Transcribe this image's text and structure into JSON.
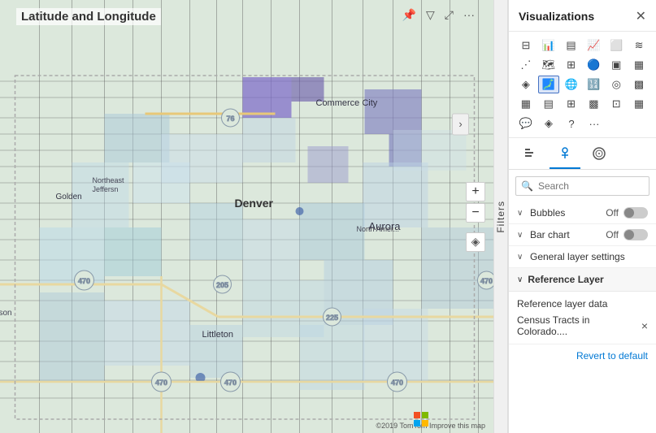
{
  "map": {
    "title": "Latitude and Longitude",
    "attribution": "©2019 TomTom  Improve this map",
    "zoom_in": "+",
    "zoom_out": "−",
    "toolbar": {
      "pin": "📌",
      "filter": "▽",
      "expand": "⤢",
      "more": "···"
    },
    "city_labels": [
      "Commerce City",
      "Golden",
      "Northeast Jeffersn",
      "Denver",
      "Aurora",
      "Littleton",
      "son"
    ],
    "highway_labels": [
      "470",
      "205",
      "225",
      "76",
      "470",
      "470",
      "470",
      "470"
    ]
  },
  "filters_tab": {
    "label": "Filters"
  },
  "visualizations": {
    "title": "Visualizations",
    "close_label": "✕",
    "icon_rows": [
      [
        "▦",
        "📊",
        "▤",
        "📈",
        "🔲",
        "▦"
      ],
      [
        "📉",
        "🗺",
        "▤",
        "🔵",
        "🔢",
        "▦"
      ],
      [
        "🔷",
        "🗺",
        "🌐",
        "🔢",
        "▩",
        "▦"
      ],
      [
        "▦",
        "▤",
        "⊞",
        "▩",
        "⊡",
        "▦"
      ],
      [
        "💬",
        "◈",
        "▦",
        "···",
        "",
        ""
      ]
    ],
    "subtabs": [
      {
        "label": "⊞",
        "active": false
      },
      {
        "label": "🖊",
        "active": true
      },
      {
        "label": "🌐",
        "active": false
      }
    ],
    "search": {
      "placeholder": "Search",
      "icon": "🔍"
    },
    "settings": [
      {
        "label": "Bubbles",
        "value": "Off",
        "has_toggle": true,
        "toggle_on": false,
        "collapsed": false,
        "chevron": "∨"
      },
      {
        "label": "Bar chart",
        "value": "Off",
        "has_toggle": true,
        "toggle_on": false,
        "collapsed": false,
        "chevron": "∨"
      },
      {
        "label": "General layer settings",
        "value": "",
        "has_toggle": false,
        "collapsed": false,
        "chevron": "∨"
      },
      {
        "label": "Reference Layer",
        "value": "",
        "has_toggle": false,
        "collapsed": false,
        "chevron": "∨"
      }
    ],
    "reference_layer": {
      "data_label": "Reference layer data",
      "census_label": "Census Tracts in Colorado....",
      "close_btn": "×",
      "revert_label": "Revert to default"
    }
  }
}
